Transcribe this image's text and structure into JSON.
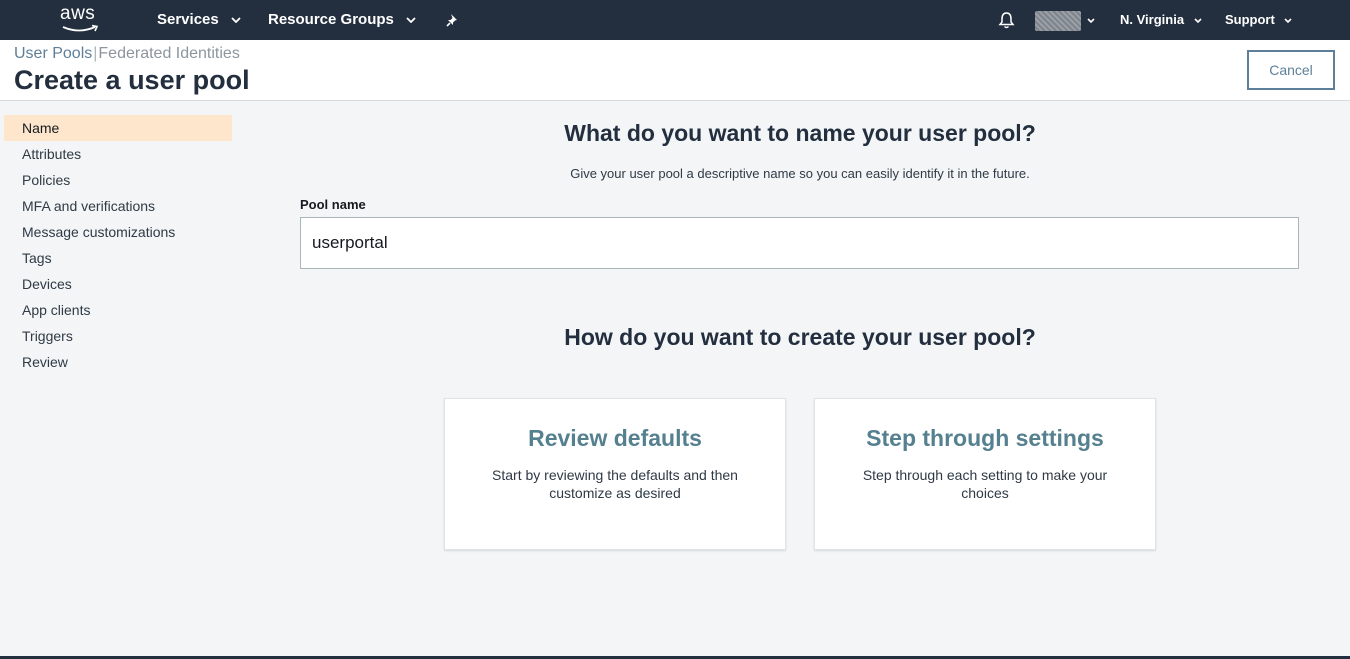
{
  "nav": {
    "logo": "aws",
    "services": "Services",
    "resource_groups": "Resource Groups",
    "pin_icon": "pin-icon",
    "bell_icon": "bell-icon",
    "region": "N. Virginia",
    "support": "Support"
  },
  "header": {
    "breadcrumb_active": "User Pools",
    "breadcrumb_inactive": "Federated Identities",
    "title": "Create a user pool",
    "cancel": "Cancel"
  },
  "sidebar": {
    "items": [
      {
        "label": "Name",
        "active": true
      },
      {
        "label": "Attributes"
      },
      {
        "label": "Policies"
      },
      {
        "label": "MFA and verifications"
      },
      {
        "label": "Message customizations"
      },
      {
        "label": "Tags"
      },
      {
        "label": "Devices"
      },
      {
        "label": "App clients"
      },
      {
        "label": "Triggers"
      },
      {
        "label": "Review"
      }
    ]
  },
  "main": {
    "name_heading": "What do you want to name your user pool?",
    "name_description": "Give your user pool a descriptive name so you can easily identify it in the future.",
    "pool_name_label": "Pool name",
    "pool_name_value": "userportal",
    "create_heading": "How do you want to create your user pool?",
    "options": [
      {
        "title": "Review defaults",
        "description": "Start by reviewing the defaults and then customize as desired"
      },
      {
        "title": "Step through settings",
        "description": "Step through each setting to make your choices"
      }
    ]
  },
  "colors": {
    "nav_bg": "#232f3e",
    "active_sidebar_bg": "#fde6cc",
    "card_title": "#55808f",
    "link": "#5d7f99"
  }
}
